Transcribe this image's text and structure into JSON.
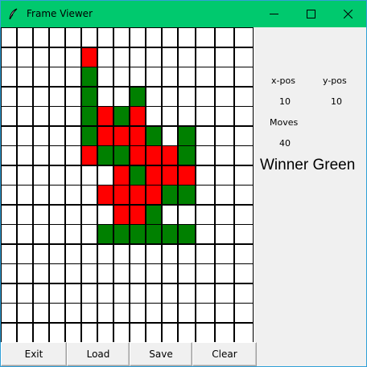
{
  "window": {
    "title": "Frame Viewer",
    "title_bar_color": "#00c96e",
    "icon": "feather-icon"
  },
  "caption_buttons": {
    "minimize": "minimize-icon",
    "maximize": "maximize-icon",
    "close": "close-icon"
  },
  "board": {
    "columns": 15,
    "rows": 16,
    "colors": {
      "r": "#ff0000",
      "g": "#008000"
    },
    "cells": [
      "...............",
      ".....r.........",
      ".....g.........",
      ".....g..g......",
      ".....grgr......",
      ".....grrrg.g...",
      ".....rggrrrg...",
      ".......rgrrr...",
      "......rrrrgg...",
      ".......rrg.....",
      "......gggggg...",
      "...............",
      "...............",
      "...............",
      "...............",
      "..............."
    ]
  },
  "status": {
    "xpos_label": "x-pos",
    "ypos_label": "y-pos",
    "xpos_value": "10",
    "ypos_value": "10",
    "moves_label": "Moves",
    "moves_value": "40",
    "winner_text": "Winner Green"
  },
  "buttons": {
    "exit": "Exit",
    "load": "Load",
    "save": "Save",
    "clear": "Clear"
  }
}
